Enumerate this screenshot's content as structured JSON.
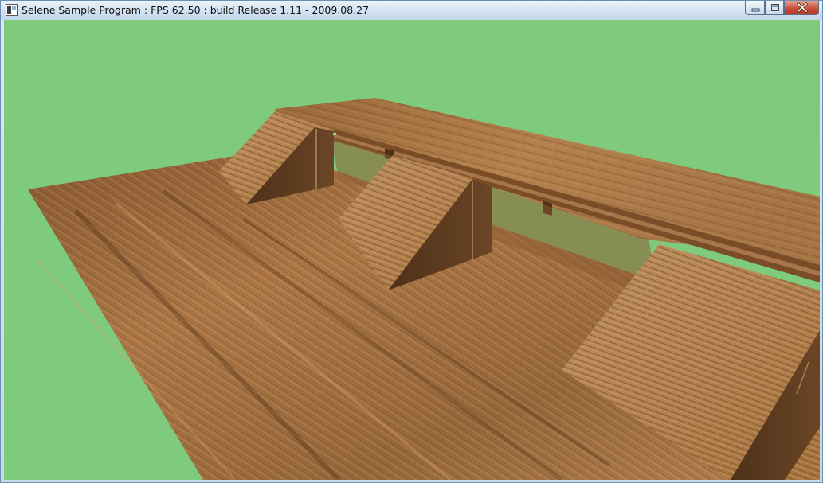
{
  "window": {
    "title": "Selene Sample Program : FPS 62.50 : build Release 1.11 - 2009.08.27"
  },
  "controls": {
    "minimize_icon": "minimize-icon",
    "maximize_icon": "maximize-icon",
    "close_icon": "close-icon"
  },
  "scene": {
    "background_color": "#7fcb7d",
    "wood_light": "#b98652",
    "wood_dark": "#6e4727"
  }
}
